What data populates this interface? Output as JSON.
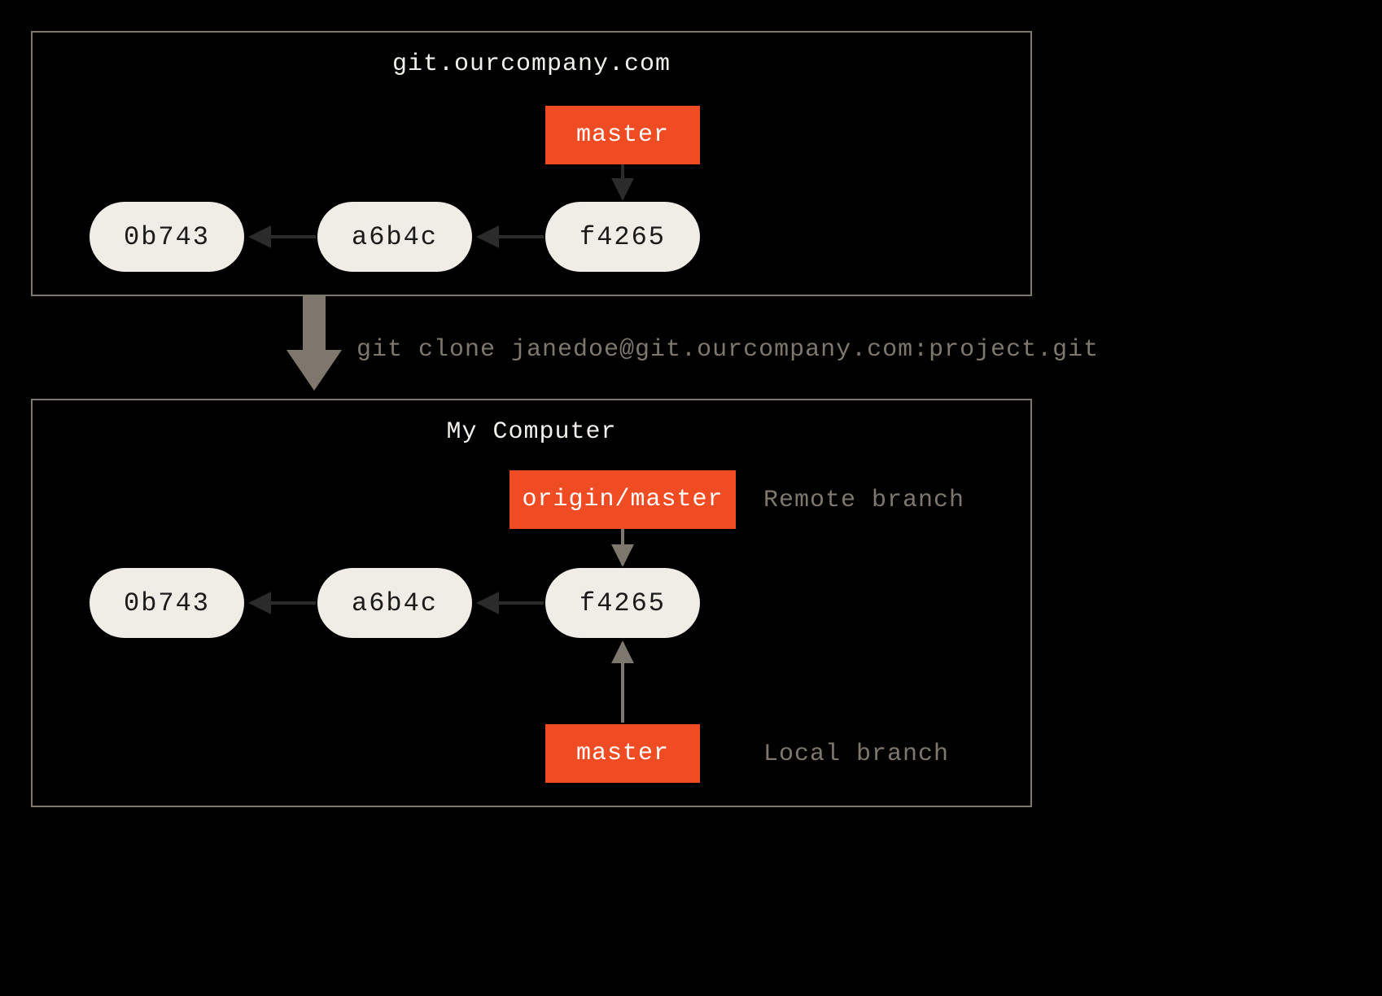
{
  "colors": {
    "bg": "#000000",
    "panel_border": "#7d776e",
    "commit_fill": "#efede5",
    "commit_text": "#1a1a1a",
    "branch_fill": "#f04c23",
    "branch_text": "#ffffff",
    "muted_text": "#7d776e",
    "light_text": "#F2F0EB"
  },
  "remote": {
    "title": "git.ourcompany.com",
    "commits": [
      "0b743",
      "a6b4c",
      "f4265"
    ],
    "branch": {
      "name": "master"
    }
  },
  "clone": {
    "command": "git clone janedoe@git.ourcompany.com:project.git"
  },
  "local": {
    "title": "My Computer",
    "commits": [
      "0b743",
      "a6b4c",
      "f4265"
    ],
    "remote_branch": {
      "name": "origin/master",
      "label": "Remote branch"
    },
    "local_branch": {
      "name": "master",
      "label": "Local branch"
    }
  }
}
